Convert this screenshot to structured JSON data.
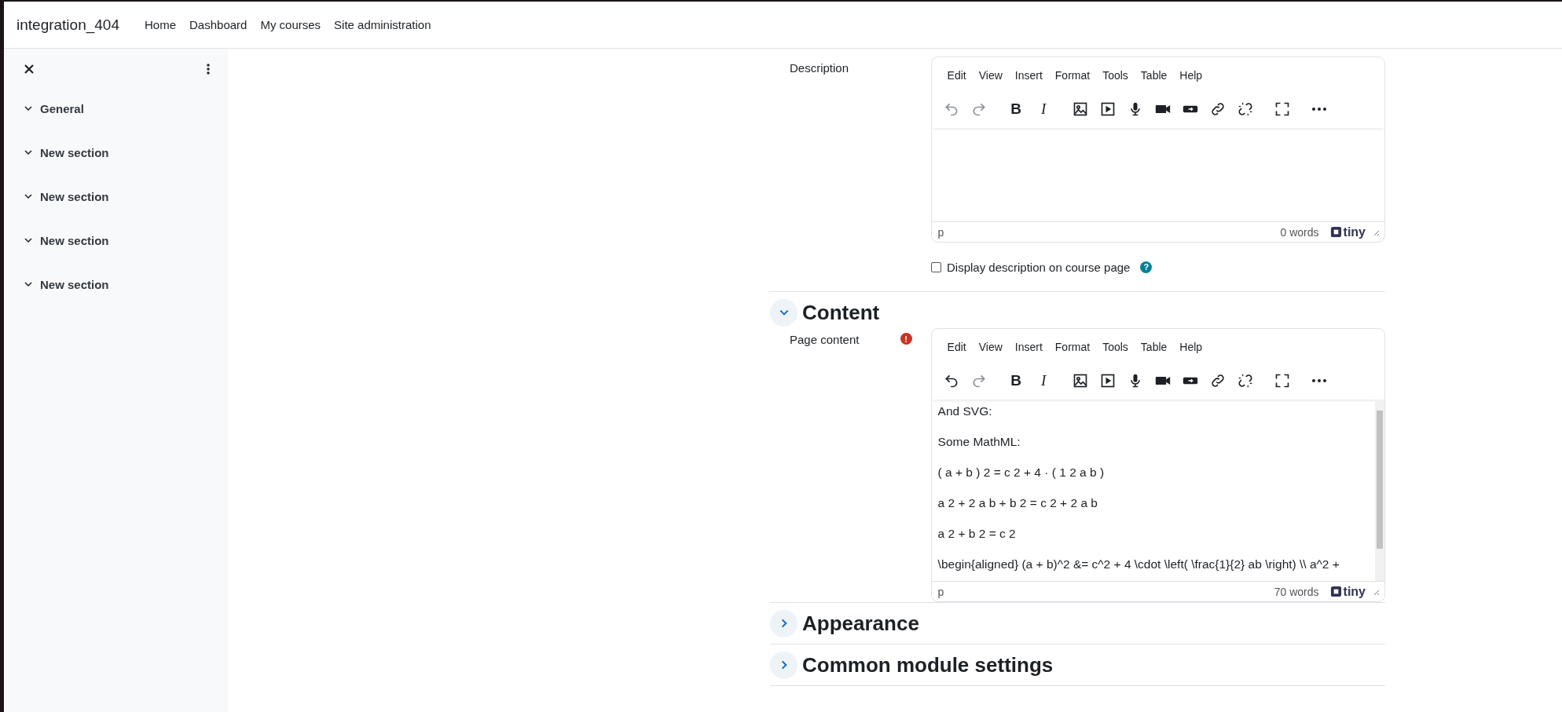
{
  "navbar": {
    "brand": "integration_404",
    "links": [
      "Home",
      "Dashboard",
      "My courses",
      "Site administration"
    ]
  },
  "sidebar": {
    "items": [
      {
        "label": "General",
        "expanded": true
      },
      {
        "label": "New section",
        "expanded": true
      },
      {
        "label": "New section",
        "expanded": true
      },
      {
        "label": "New section",
        "expanded": true
      },
      {
        "label": "New section",
        "expanded": true
      }
    ]
  },
  "description": {
    "label": "Description",
    "editor": {
      "menu": [
        "Edit",
        "View",
        "Insert",
        "Format",
        "Tools",
        "Table",
        "Help"
      ],
      "toolbar": [
        [
          {
            "kind": "undo",
            "disabled": true
          },
          {
            "kind": "redo",
            "disabled": true
          }
        ],
        [
          {
            "kind": "bold",
            "label": "B",
            "disabled": false
          },
          {
            "kind": "italic",
            "label": "I",
            "disabled": false
          }
        ],
        [
          {
            "kind": "image",
            "disabled": false
          },
          {
            "kind": "media",
            "disabled": false
          },
          {
            "kind": "mic",
            "disabled": false
          },
          {
            "kind": "video",
            "disabled": false
          },
          {
            "kind": "h5p",
            "disabled": false
          },
          {
            "kind": "link",
            "disabled": false
          },
          {
            "kind": "unlink",
            "disabled": false
          }
        ],
        [
          {
            "kind": "fullscreen",
            "disabled": false
          }
        ],
        [
          {
            "kind": "more",
            "disabled": false
          }
        ]
      ],
      "path": "p",
      "word_count": "0 words",
      "brand": "tiny"
    },
    "checkbox": {
      "label": "Display description on course page",
      "checked": false,
      "help": "?"
    }
  },
  "sections": [
    {
      "title": "Content",
      "expanded": true,
      "field": {
        "label": "Page content",
        "error": "!",
        "editor": {
          "menu": [
            "Edit",
            "View",
            "Insert",
            "Format",
            "Tools",
            "Table",
            "Help"
          ],
          "toolbar": [
            [
              {
                "kind": "undo",
                "disabled": false
              },
              {
                "kind": "redo",
                "disabled": true
              }
            ],
            [
              {
                "kind": "bold",
                "label": "B",
                "disabled": false
              },
              {
                "kind": "italic",
                "label": "I",
                "disabled": false
              }
            ],
            [
              {
                "kind": "image",
                "disabled": false
              },
              {
                "kind": "media",
                "disabled": false
              },
              {
                "kind": "mic",
                "disabled": false
              },
              {
                "kind": "video",
                "disabled": false
              },
              {
                "kind": "h5p",
                "disabled": false
              },
              {
                "kind": "link",
                "disabled": false
              },
              {
                "kind": "unlink",
                "disabled": false
              }
            ],
            [
              {
                "kind": "fullscreen",
                "disabled": false
              }
            ],
            [
              {
                "kind": "more",
                "disabled": false
              }
            ]
          ],
          "paragraphs": [
            "And SVG:",
            "Some MathML:",
            "( a + b ) 2 = c 2 + 4 · ( 1 2 a b )",
            "a 2 + 2 a b + b 2 = c 2 + 2 a b",
            "a 2 + b 2 = c 2",
            "\\begin{aligned} (a + b)^2 &= c^2 + 4 \\cdot \\left( \\frac{1}{2} ab \\right) \\\\ a^2 +"
          ],
          "path": "p",
          "word_count": "70 words",
          "brand": "tiny"
        }
      }
    },
    {
      "title": "Appearance",
      "expanded": false
    },
    {
      "title": "Common module settings",
      "expanded": false
    }
  ]
}
